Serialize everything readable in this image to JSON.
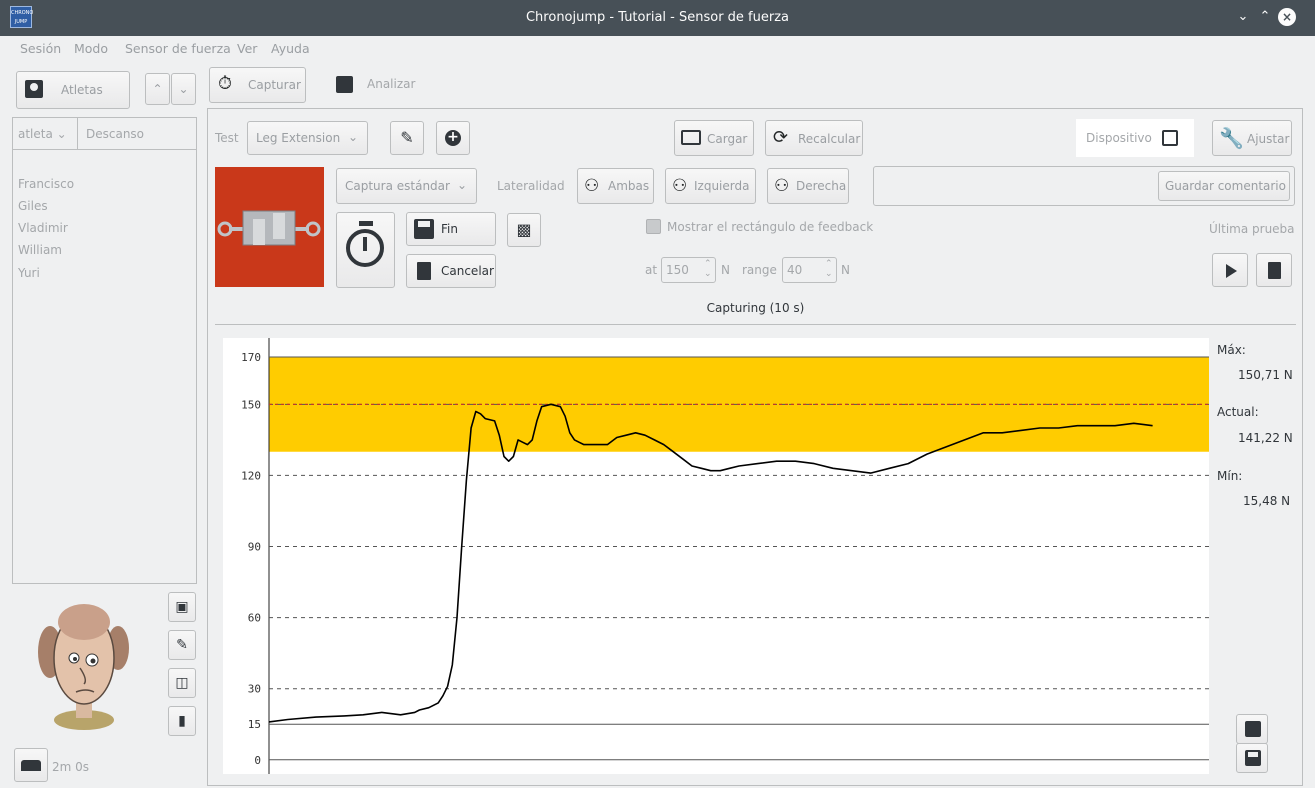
{
  "window": {
    "title": "Chronojump - Tutorial - Sensor de fuerza",
    "logo_text": "CHRONO JUMP"
  },
  "menu": [
    "Sesión",
    "Modo",
    "Sensor de fuerza",
    "Ver",
    "Ayuda"
  ],
  "sidebar": {
    "athletes_label": "Atletas",
    "col_athlete": "atleta",
    "col_rest": "Descanso",
    "athletes": [
      "Francisco",
      "Giles",
      "Vladimir",
      "William",
      "Yuri"
    ],
    "rest_time": "2m 0s"
  },
  "tabs": {
    "capture": "Capturar",
    "analyze": "Analizar"
  },
  "toolbar": {
    "test_label": "Test",
    "test_value": "Leg Extension",
    "load": "Cargar",
    "recalculate": "Recalcular",
    "device": "Dispositivo",
    "adjust": "Ajustar"
  },
  "capture": {
    "capture_mode": "Captura estándar",
    "laterality_label": "Lateralidad",
    "both": "Ambas",
    "left": "Izquierda",
    "right": "Derecha",
    "comment_placeholder": "",
    "save_comment": "Guardar comentario",
    "finish": "Fin",
    "cancel": "Cancelar",
    "feedback_checkbox": "Mostrar el rectángulo de feedback",
    "at_label": "at",
    "at_value": "150",
    "unit_n": "N",
    "range_label": "range",
    "range_value": "40",
    "last_test": "Última prueba",
    "status": "Capturing (10 s)"
  },
  "readouts": {
    "max_label": "Máx:",
    "max_value": "150,71 N",
    "current_label": "Actual:",
    "current_value": "141,22 N",
    "min_label": "Mín:",
    "min_value": "15,48 N"
  },
  "colors": {
    "feedback_band": "#ffcc00",
    "titlebar": "#475057",
    "target_line": "#c0392b"
  },
  "chart_data": {
    "type": "line",
    "ylim": [
      -6,
      178
    ],
    "yticks": [
      0,
      15,
      30,
      60,
      90,
      120,
      150,
      170
    ],
    "feedback_band": [
      130,
      170
    ],
    "target": 150,
    "series": [
      {
        "x": [
          0,
          0.02,
          0.05,
          0.08,
          0.1,
          0.12,
          0.14,
          0.155,
          0.16,
          0.17,
          0.18,
          0.185,
          0.19,
          0.195,
          0.2,
          0.205,
          0.21,
          0.215,
          0.22,
          0.225,
          0.23,
          0.24,
          0.245,
          0.25,
          0.255,
          0.26,
          0.265,
          0.27,
          0.275,
          0.28,
          0.285,
          0.29,
          0.3,
          0.31,
          0.315,
          0.32,
          0.325,
          0.33,
          0.335,
          0.34,
          0.35,
          0.36,
          0.37,
          0.38,
          0.39,
          0.4,
          0.41,
          0.42,
          0.43,
          0.44,
          0.45,
          0.46,
          0.47,
          0.48,
          0.49,
          0.5,
          0.52,
          0.54,
          0.56,
          0.58,
          0.6,
          0.62,
          0.64,
          0.66,
          0.68,
          0.7,
          0.72,
          0.74,
          0.76,
          0.78,
          0.8,
          0.82,
          0.84,
          0.86,
          0.88,
          0.9,
          0.92,
          0.94
        ],
        "y": [
          16,
          17,
          18,
          18.5,
          19,
          20,
          19,
          20,
          21,
          22,
          24,
          27,
          31,
          40,
          60,
          90,
          118,
          140,
          147,
          146,
          144,
          143,
          137,
          128,
          126,
          128,
          135,
          134,
          133,
          135,
          143,
          149,
          150,
          149,
          145,
          138,
          135,
          134,
          133,
          133,
          133,
          133,
          136,
          137,
          138,
          137,
          135,
          133,
          130,
          127,
          124,
          123,
          122,
          122,
          123,
          124,
          125,
          126,
          126,
          125,
          123,
          122,
          121,
          123,
          125,
          129,
          132,
          135,
          138,
          138,
          139,
          140,
          140,
          141,
          141,
          141,
          142,
          141
        ]
      }
    ]
  }
}
